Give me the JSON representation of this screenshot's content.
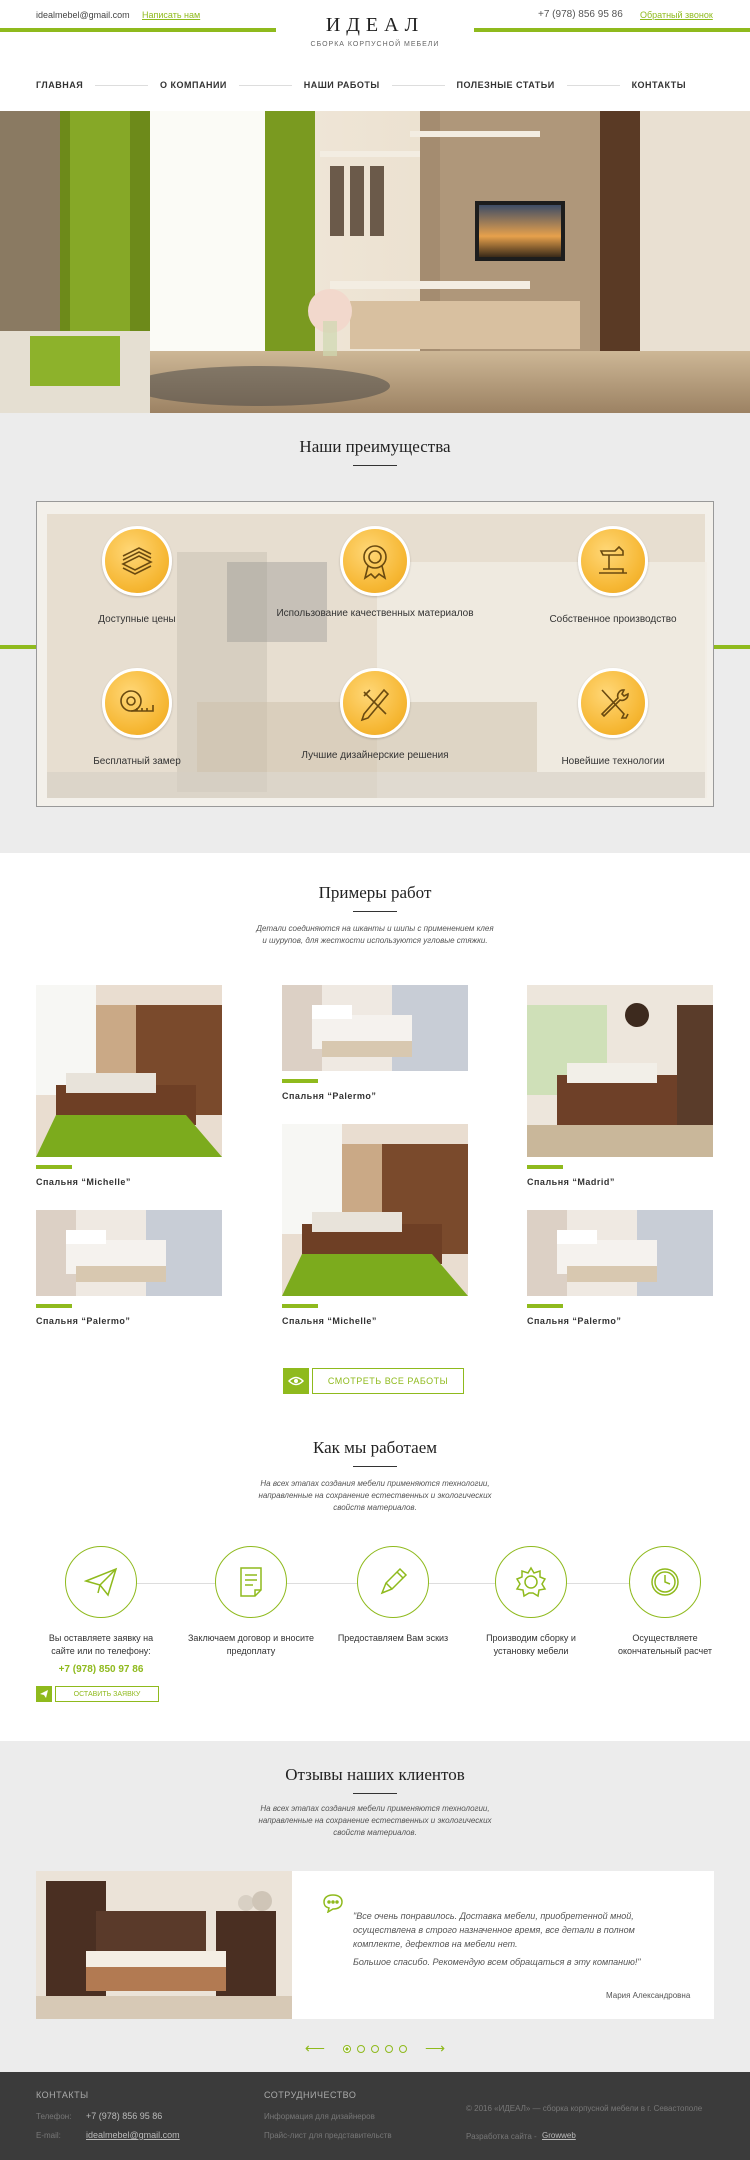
{
  "header": {
    "email": "idealmebel@gmail.com",
    "write_us": "Написать нам",
    "phone": "+7 (978) 856 95 86",
    "callback": "Обратный звонок",
    "logo": "ИДЕАЛ",
    "logo_sub": "СБОРКА КОРПУСНОЙ МЕБЕЛИ"
  },
  "nav": {
    "items": [
      "ГЛАВНАЯ",
      "О КОМПАНИИ",
      "НАШИ РАБОТЫ",
      "ПОЛЕЗНЫЕ СТАТЬИ",
      "КОНТАКТЫ"
    ]
  },
  "advantages": {
    "title": "Наши преимущества",
    "items": [
      {
        "label": "Доступные цены",
        "icon": "money-stack-icon"
      },
      {
        "label": "Использование качественных материалов",
        "icon": "quality-badge-icon"
      },
      {
        "label": "Собственное производство",
        "icon": "hammer-icon"
      },
      {
        "label": "Бесплатный замер",
        "icon": "tape-measure-icon"
      },
      {
        "label": "Лучшие дизайнерские решения",
        "icon": "design-tools-icon"
      },
      {
        "label": "Новейшие технологии",
        "icon": "wrench-screwdriver-icon"
      }
    ],
    "accent_color": "#f6b733"
  },
  "works": {
    "title": "Примеры работ",
    "desc": "Детали соединяются на шканты и шипы с применением клея и шурупов, для жесткости используются угловые стяжки.",
    "items": [
      {
        "caption": "Спальня “Michelle”"
      },
      {
        "caption": "Спальня “Palermo”"
      },
      {
        "caption": "Спальня “Madrid”"
      },
      {
        "caption": "Спальня “Palermo”"
      },
      {
        "caption": "Спальня “Michelle”"
      },
      {
        "caption": "Спальня “Palermo”"
      }
    ],
    "all_button": "СМОТРЕТЬ ВСЕ РАБОТЫ"
  },
  "how": {
    "title": "Как мы работаем",
    "desc": "На всех этапах создания мебели применяются технологии, направленные на сохранение естественных и экологических свойств материалов.",
    "steps": [
      {
        "text": "Вы оставляете заявку на сайте или по телефону:",
        "icon": "paper-plane-icon"
      },
      {
        "text": "Заключаем договор и вносите предоплату",
        "icon": "document-icon"
      },
      {
        "text": "Предоставляем Вам эскиз",
        "icon": "pencil-icon"
      },
      {
        "text": "Производим сборку и установку мебели",
        "icon": "gear-icon"
      },
      {
        "text": "Осуществляете окончательный расчет",
        "icon": "clock-icon"
      }
    ],
    "phone": "+7 (978) 850 97 86",
    "order_button": "ОСТАВИТЬ ЗАЯВКУ"
  },
  "reviews": {
    "title": "Отзывы наших клиентов",
    "desc": "На всех этапах создания мебели применяются технологии, направленные на сохранение естественных и экологических свойств материалов.",
    "quote1": "\"Все очень понравилось. Доставка мебели, приобретенной мной, осуществлена в строго назначенное время, все детали в полном комплекте, дефектов на мебели нет.",
    "quote2": "Большое спасибо. Рекомендую всем обращаться в эту компанию!\"",
    "author": "Мария Александровна",
    "pages": 5,
    "active_page": 1
  },
  "footer": {
    "contacts_title": "КОНТАКТЫ",
    "phone_label": "Телефон:",
    "phone": "+7 (978) 856 95 86",
    "email_label": "E-mail:",
    "email": "idealmebel@gmail.com",
    "coop_title": "СОТРУДНИЧЕСТВО",
    "coop_1": "Информация для дизайнеров",
    "coop_2": "Прайс-лист для представительств",
    "copyright": "© 2016 «ИДЕАЛ» — сборка корпусной мебели в г. Севастополе",
    "dev_label": "Разработка сайта -",
    "dev": "Growweb"
  },
  "colors": {
    "brand_green": "#8fba1d",
    "footer_bg": "#3b3b3b",
    "section_bg": "#ececec"
  }
}
